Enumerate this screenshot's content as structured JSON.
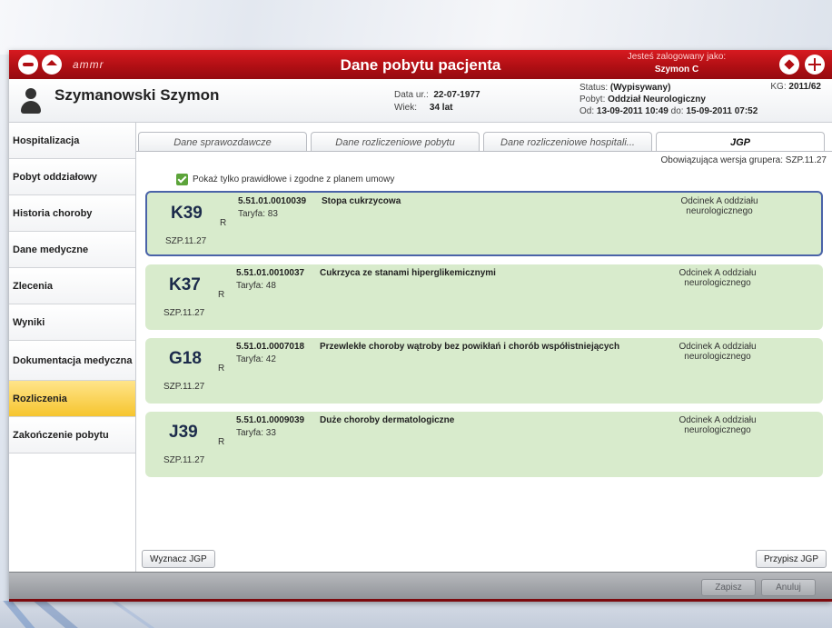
{
  "titlebar": {
    "brand": "ammr",
    "title": "Dane pobytu pacjenta",
    "login_label": "Jesteś zalogowany jako:",
    "login_user": "Szymon C"
  },
  "patient": {
    "name": "Szymanowski Szymon",
    "dob_label": "Data ur.:",
    "dob_value": "22-07-1977",
    "age_label": "Wiek:",
    "age_value": "34 lat",
    "status_label": "Status:",
    "status_value": "(Wypisywany)",
    "stay_label": "Pobyt:",
    "stay_value": "Oddział Neurologiczny",
    "from_label": "Od:",
    "from_value": "13-09-2011 10:49",
    "to_label": "do:",
    "to_value": "15-09-2011 07:52",
    "kg_label": "KG:",
    "kg_value": "2011/62"
  },
  "sidebar": {
    "items": [
      {
        "label": "Hospitalizacja"
      },
      {
        "label": "Pobyt oddziałowy"
      },
      {
        "label": "Historia choroby"
      },
      {
        "label": "Dane medyczne"
      },
      {
        "label": "Zlecenia"
      },
      {
        "label": "Wyniki"
      },
      {
        "label": "Dokumentacja medyczna"
      },
      {
        "label": "Rozliczenia"
      },
      {
        "label": "Zakończenie pobytu"
      }
    ],
    "active_index": 7
  },
  "tabs": [
    {
      "label": "Dane sprawozdawcze"
    },
    {
      "label": "Dane rozliczeniowe pobytu"
    },
    {
      "label": "Dane rozliczeniowe hospitali..."
    },
    {
      "label": "JGP"
    }
  ],
  "grouper_version": "Obowiązująca wersja grupera: SZP.11.27",
  "filter_label": "Pokaż tylko prawidłowe i zgodne z planem umowy",
  "cards": [
    {
      "code": "K39",
      "r": "R",
      "version": "SZP.11.27",
      "number": "5.51.01.0010039",
      "tariff": "Taryfa: 83",
      "description": "Stopa cukrzycowa",
      "department": "Odcinek A oddziału neurologicznego"
    },
    {
      "code": "K37",
      "r": "R",
      "version": "SZP.11.27",
      "number": "5.51.01.0010037",
      "tariff": "Taryfa: 48",
      "description": "Cukrzyca ze stanami hiperglikemicznymi",
      "department": "Odcinek A oddziału neurologicznego"
    },
    {
      "code": "G18",
      "r": "R",
      "version": "SZP.11.27",
      "number": "5.51.01.0007018",
      "tariff": "Taryfa: 42",
      "description": "Przewlekłe choroby wątroby bez powikłań i chorób współistniejących",
      "department": "Odcinek A oddziału neurologicznego"
    },
    {
      "code": "J39",
      "r": "R",
      "version": "SZP.11.27",
      "number": "5.51.01.0009039",
      "tariff": "Taryfa: 33",
      "description": "Duże choroby dermatologiczne",
      "department": "Odcinek A oddziału neurologicznego"
    }
  ],
  "buttons": {
    "wyznacz": "Wyznacz JGP",
    "przypisz": "Przypisz JGP",
    "zapisz": "Zapisz",
    "anuluj": "Anuluj"
  },
  "colors": {
    "titlebar_red": "#b10f14",
    "card_green": "#d8ebcc",
    "active_yellow": "#f6c52e",
    "selected_border": "#4a63a8"
  }
}
